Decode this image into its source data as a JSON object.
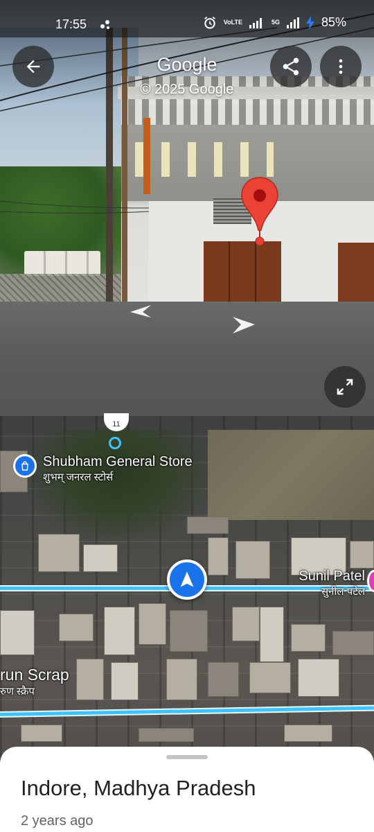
{
  "status_bar": {
    "time": "17:55",
    "battery": "85%",
    "icons": [
      "signal-share-icon",
      "alarm-icon",
      "volte-icon",
      "signal-bars-icon",
      "5g-signal-icon",
      "charging-icon"
    ],
    "network_labels": {
      "volte": "VoLTE",
      "fiveg": "5G"
    }
  },
  "street_view": {
    "title": "Google",
    "copyright": "© 2025 Google",
    "buttons": {
      "back": "back-arrow-icon",
      "share": "share-icon",
      "more": "more-vert-icon",
      "expand": "expand-icon"
    }
  },
  "map": {
    "pois": {
      "shubham": {
        "name": "Shubham General Store",
        "name_hi": "शुभम् जनरल स्टोर्स"
      },
      "sunil": {
        "name": "Sunil Patel",
        "name_hi": "सुनील पटेल"
      },
      "arun": {
        "name": "run Scrap",
        "name_hi": "रुण स्क्रैप"
      }
    },
    "transit_badge": "11"
  },
  "sheet": {
    "title": "Indore, Madhya Pradesh",
    "subtitle": "2 years ago"
  },
  "colors": {
    "accent": "#1a73e8",
    "pin": "#ea4335",
    "road": "#3ec3ff"
  }
}
